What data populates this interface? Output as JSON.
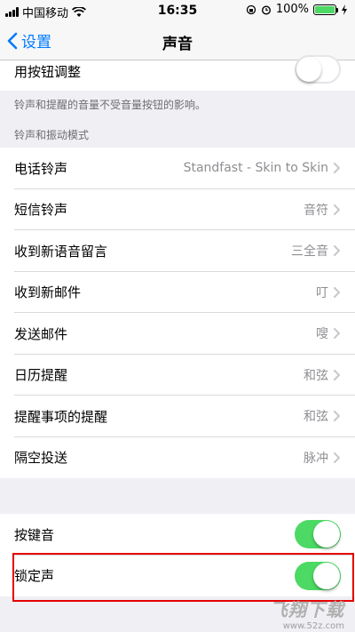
{
  "status_bar": {
    "carrier": "中国移动",
    "time": "16:35",
    "battery": "100%",
    "battery_level": 1.0
  },
  "nav": {
    "back_label": "设置",
    "title": "声音"
  },
  "top_group": {
    "label": "用按钮调整",
    "toggle_on": false
  },
  "note": "铃声和提醒的音量不受音量按钮的影响。",
  "section_header": "铃声和振动模式",
  "sounds": [
    {
      "label": "电话铃声",
      "value": "Standfast - Skin to Skin"
    },
    {
      "label": "短信铃声",
      "value": "音符"
    },
    {
      "label": "收到新语音留言",
      "value": "三全音"
    },
    {
      "label": "收到新邮件",
      "value": "叮"
    },
    {
      "label": "发送邮件",
      "value": "嗖"
    },
    {
      "label": "日历提醒",
      "value": "和弦"
    },
    {
      "label": "提醒事项的提醒",
      "value": "和弦"
    },
    {
      "label": "隔空投送",
      "value": "脉冲"
    }
  ],
  "toggles": [
    {
      "label": "按键音",
      "on": true
    },
    {
      "label": "锁定声",
      "on": true
    }
  ],
  "watermark": {
    "main": "飞翔下载",
    "sub": "www.52z.com"
  },
  "colors": {
    "accent": "#007aff",
    "toggle_on": "#4cd964",
    "highlight": "#e60000"
  }
}
